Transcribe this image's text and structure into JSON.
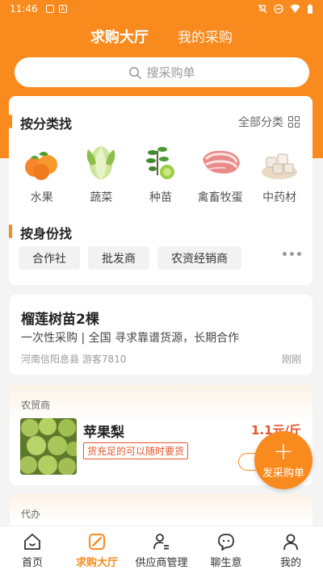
{
  "status": {
    "time": "11:46"
  },
  "header": {
    "tabs": [
      {
        "label": "求购大厅",
        "active": true
      },
      {
        "label": "我的采购",
        "active": false
      }
    ]
  },
  "search": {
    "placeholder": "搜采购单"
  },
  "category_section": {
    "title": "按分类找",
    "all_label": "全部分类",
    "items": [
      {
        "label": "水果",
        "icon": "oranges-icon"
      },
      {
        "label": "蔬菜",
        "icon": "cabbage-icon"
      },
      {
        "label": "种苗",
        "icon": "seedling-icon"
      },
      {
        "label": "禽畜牧蛋",
        "icon": "pork-icon"
      },
      {
        "label": "中药材",
        "icon": "herb-icon"
      }
    ]
  },
  "identity_section": {
    "title": "按身份找",
    "chips": [
      "合作社",
      "批发商",
      "农资经销商"
    ]
  },
  "request": {
    "title": "榴莲树苗2棵",
    "desc": "一次性采购 | 全国 寻求靠谱货源，长期合作",
    "location": "河南信阳息县 游客7810",
    "time": "刚刚"
  },
  "supply": {
    "tag": "农贸商",
    "name": "苹果梨",
    "badge": "货充足的可以随时要货",
    "price": "1.1元/斤"
  },
  "agent": {
    "tag": "代办"
  },
  "fab": {
    "label": "发采购单"
  },
  "bottom_nav": [
    {
      "label": "首页",
      "icon": "home-icon",
      "active": false
    },
    {
      "label": "求购大厅",
      "icon": "edit-icon",
      "active": true
    },
    {
      "label": "供应商管理",
      "icon": "supplier-icon",
      "active": false
    },
    {
      "label": "聊生意",
      "icon": "chat-icon",
      "active": false
    },
    {
      "label": "我的",
      "icon": "user-icon",
      "active": false
    }
  ],
  "colors": {
    "accent": "#f98a1d",
    "price": "#e8542a"
  }
}
